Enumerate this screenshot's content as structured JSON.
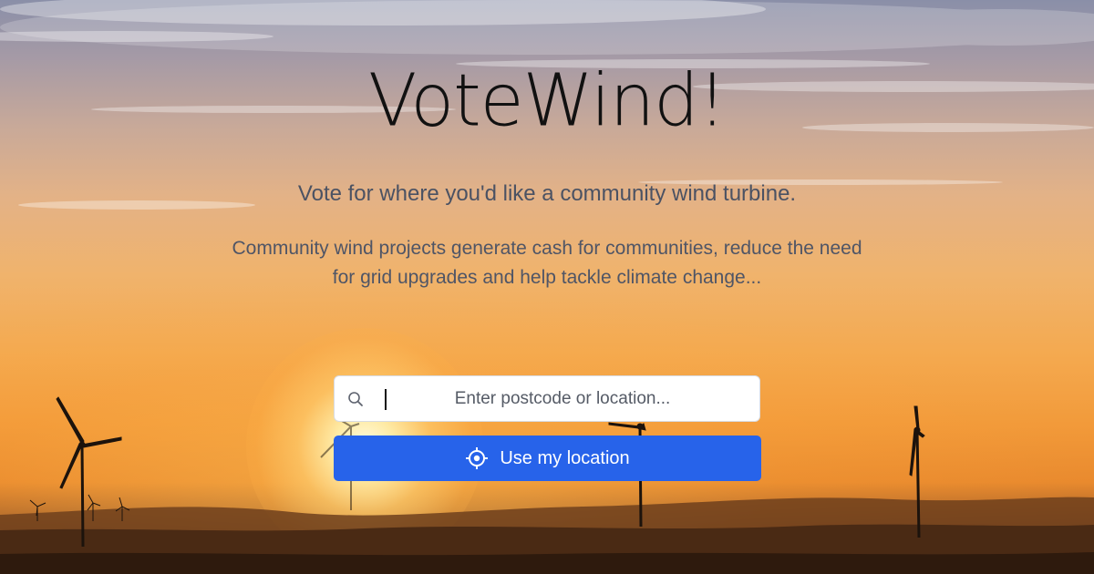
{
  "hero": {
    "title": "VoteWind!",
    "subtitle": "Vote for where you'd like a community wind turbine.",
    "blurb": "Community wind projects generate cash for communities, reduce the need for grid upgrades and help tackle climate change..."
  },
  "search": {
    "placeholder": "Enter postcode or location...",
    "value": "",
    "icon": "search-icon"
  },
  "location_button": {
    "label": "Use my location",
    "icon": "crosshair-target-icon",
    "color": "#2763ea"
  },
  "background": {
    "scene": "sunset-wind-turbines",
    "colors": {
      "sky_top": "#8a8fa8",
      "sky_mid": "#f0b36c",
      "horizon": "#e98a2e",
      "ground": "#3b2516"
    }
  }
}
